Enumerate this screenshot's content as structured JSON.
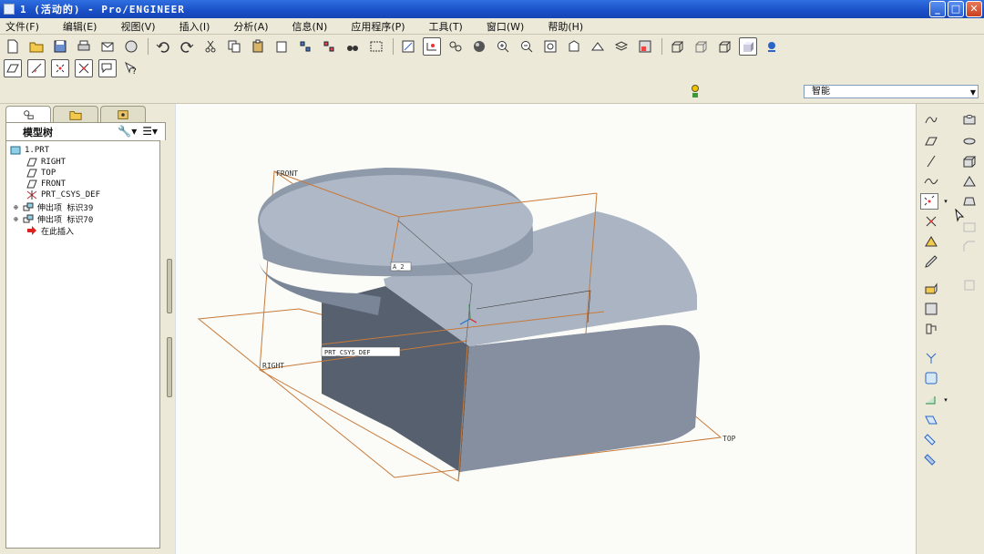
{
  "window": {
    "title": "1 (活动的) - Pro/ENGINEER",
    "controls": [
      "minimize",
      "maximize",
      "close"
    ]
  },
  "menu": [
    "文件(F)",
    "编辑(E)",
    "视图(V)",
    "插入(I)",
    "分析(A)",
    "信息(N)",
    "应用程序(P)",
    "工具(T)",
    "窗口(W)",
    "帮助(H)"
  ],
  "filter": {
    "value": "智能"
  },
  "model_tree": {
    "title": "模型树",
    "items": [
      {
        "label": "1.PRT",
        "icon": "part-icon"
      },
      {
        "label": "RIGHT",
        "icon": "datum-plane-icon"
      },
      {
        "label": "TOP",
        "icon": "datum-plane-icon"
      },
      {
        "label": "FRONT",
        "icon": "datum-plane-icon"
      },
      {
        "label": "PRT_CSYS_DEF",
        "icon": "csys-icon"
      },
      {
        "label": "伸出项 标识39",
        "icon": "extrude-icon"
      },
      {
        "label": "伸出项 标识70",
        "icon": "extrude-icon"
      },
      {
        "label": "在此插入",
        "icon": "insert-here-icon"
      }
    ]
  },
  "viewport": {
    "datum_labels": {
      "front": "FRONT",
      "right": "RIGHT",
      "top": "TOP",
      "axis_tag": "A_2",
      "csys": "PRT_CSYS_DEF"
    },
    "colors": {
      "background": "#fbfbf7",
      "datum_line": "#c87a3a",
      "solid_top": "#aab4c3",
      "solid_side": "#6f7b8d",
      "solid_dark": "#56606f"
    }
  }
}
